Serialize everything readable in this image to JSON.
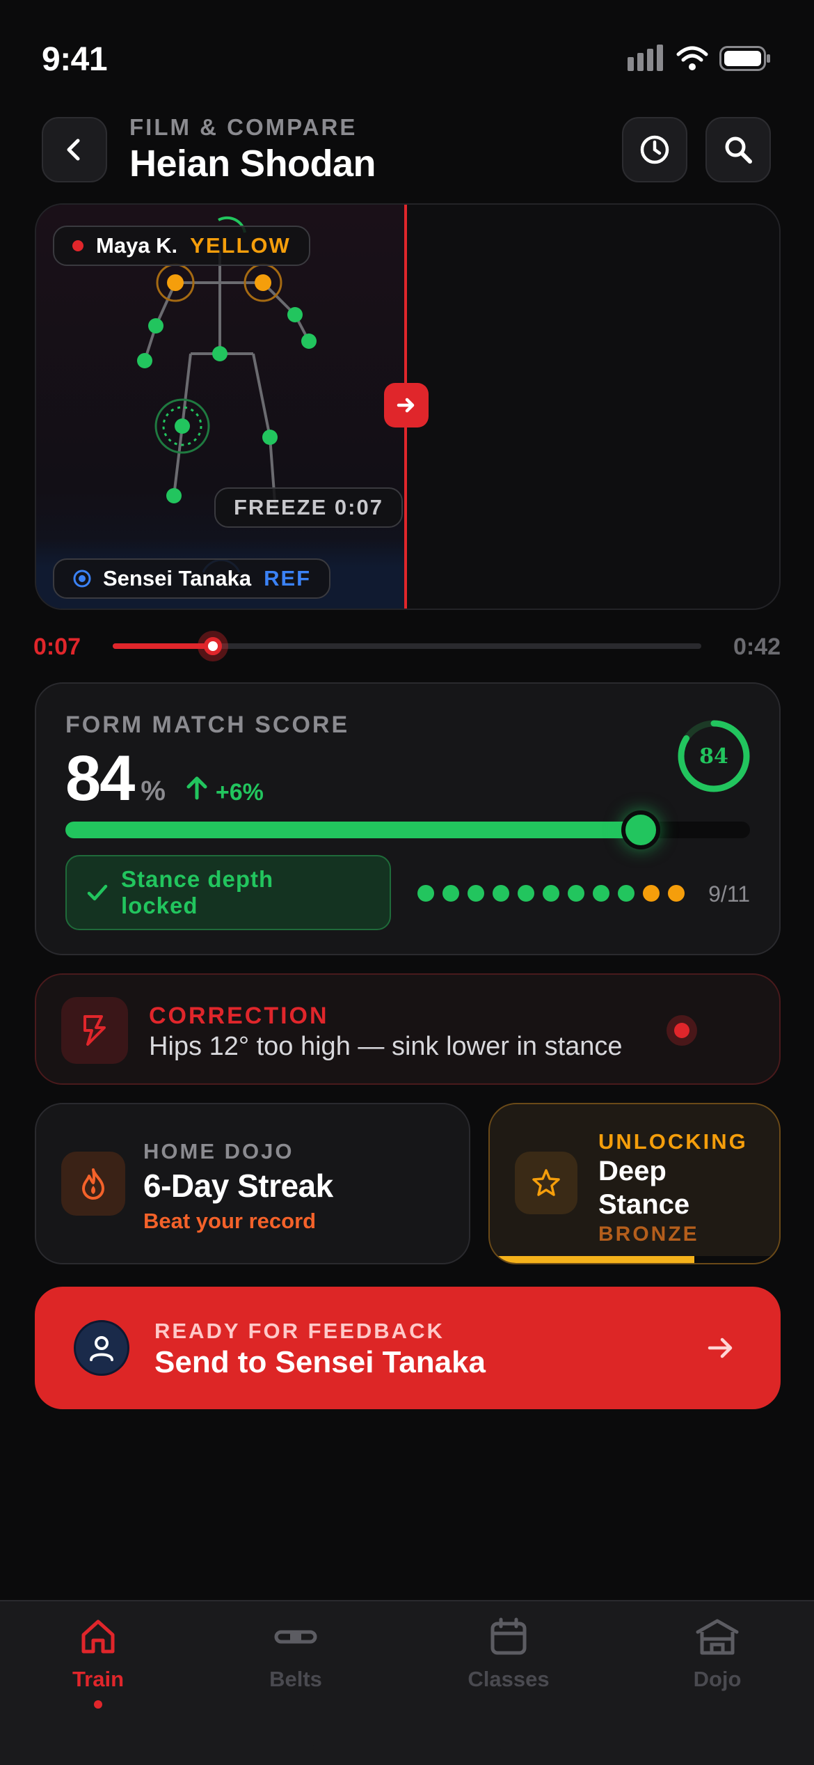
{
  "status_bar": {
    "time": "9:41"
  },
  "header": {
    "eyebrow": "FILM & COMPARE",
    "title": "Heian Shodan"
  },
  "video": {
    "student_chip": {
      "name": "Maya K.",
      "belt": "YELLOW"
    },
    "reference_chip": {
      "name": "Sensei Tanaka",
      "tag": "REF"
    },
    "freeze_label": "FREEZE 0:07"
  },
  "scrubber": {
    "current": "0:07",
    "total": "0:42",
    "progress": 0.17
  },
  "score": {
    "label": "FORM MATCH SCORE",
    "value": "84",
    "unit": "%",
    "delta": "+6%",
    "ring_value": "84",
    "fraction": 0.84,
    "chip": "Stance depth locked",
    "checkpoints_count": "9/11",
    "checkpoints_done": 9,
    "checkpoints_total": 11
  },
  "correction": {
    "label": "CORRECTION",
    "text": "Hips 12° too high — sink lower in stance"
  },
  "streak": {
    "label": "HOME DOJO",
    "title": "6-Day Streak",
    "subtitle": "Beat your record"
  },
  "unlocking": {
    "label": "UNLOCKING",
    "title_line1": "Deep",
    "title_line2": "Stance",
    "tier": "BRONZE",
    "progress": 0.7
  },
  "cta": {
    "eyebrow": "READY FOR FEEDBACK",
    "title": "Send to Sensei Tanaka"
  },
  "tabs": [
    {
      "label": "Train",
      "icon": "home-icon",
      "active": true
    },
    {
      "label": "Belts",
      "icon": "belt-icon",
      "active": false
    },
    {
      "label": "Classes",
      "icon": "calendar-icon",
      "active": false
    },
    {
      "label": "Dojo",
      "icon": "dojo-icon",
      "active": false
    }
  ],
  "colors": {
    "accent_red": "#e0262b",
    "green": "#22c55e",
    "orange": "#f59e0b",
    "blue": "#3b82f6",
    "bg": "#0b0b0c"
  }
}
